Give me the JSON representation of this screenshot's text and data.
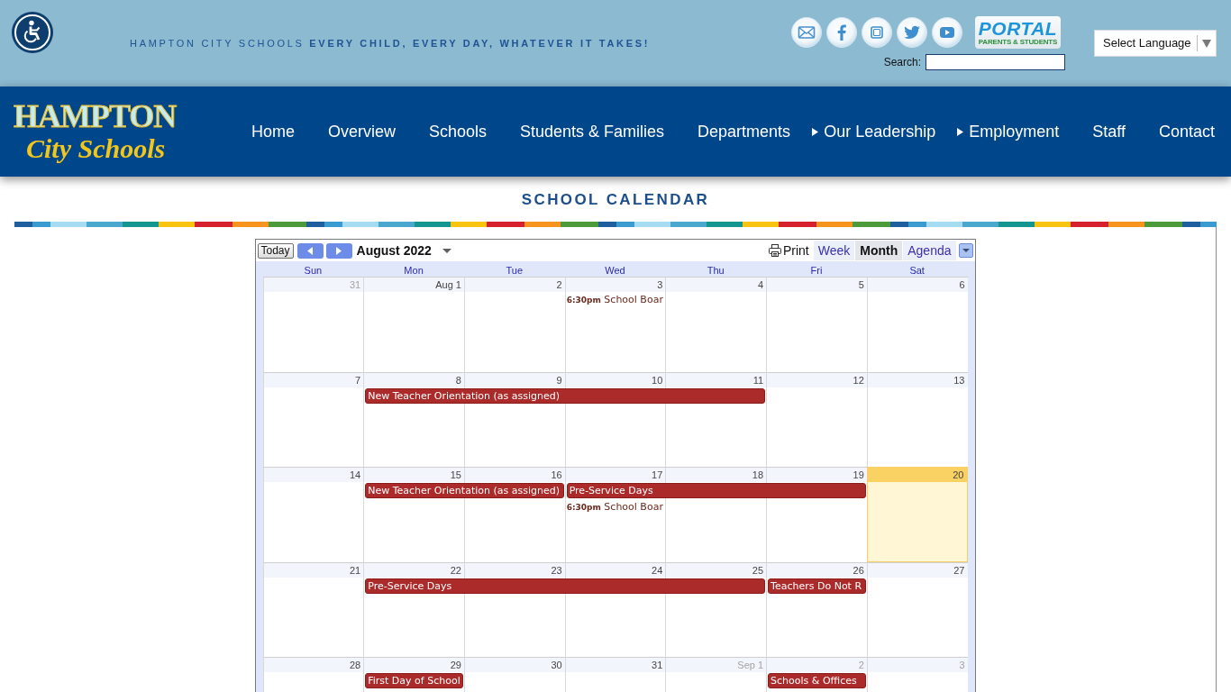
{
  "header": {
    "tagline": "HAMPTON CITY SCHOOLS **EVERY CHILD, EVERY DAY, WHATEVER IT TAKES!**",
    "portal": {
      "title": "PORTAL",
      "subtitle": "PARENTS & STUDENTS"
    },
    "search": {
      "label": "Search:"
    },
    "language_select": {
      "value": "Select Language"
    }
  },
  "logo": {
    "wordmark": "HAMPTON",
    "script": "City Schools"
  },
  "nav": [
    {
      "label": "Home",
      "submenu": false
    },
    {
      "label": "Overview",
      "submenu": false
    },
    {
      "label": "Schools",
      "submenu": false
    },
    {
      "label": "Students & Families",
      "submenu": false
    },
    {
      "label": "Departments",
      "submenu": false
    },
    {
      "label": "Our Leadership",
      "submenu": true
    },
    {
      "label": "Employment",
      "submenu": true
    },
    {
      "label": "Staff",
      "submenu": false
    },
    {
      "label": "Contact",
      "submenu": false
    }
  ],
  "page_title": "SCHOOL CALENDAR",
  "calendar": {
    "today_button": "Today",
    "month": "August 2022",
    "print": "Print",
    "views": [
      {
        "label": "Week",
        "selected": false
      },
      {
        "label": "Month",
        "selected": true
      },
      {
        "label": "Agenda",
        "selected": false
      }
    ],
    "weekdays": [
      "Sun",
      "Mon",
      "Tue",
      "Wed",
      "Thu",
      "Fri",
      "Sat"
    ],
    "weeks": [
      {
        "days": [
          {
            "date": "31",
            "other_month": true,
            "today": false
          },
          {
            "date": "Aug 1",
            "other_month": false,
            "today": false
          },
          {
            "date": "2",
            "other_month": false,
            "today": false
          },
          {
            "date": "3",
            "other_month": false,
            "today": false,
            "events": [
              {
                "kind": "timed",
                "time": "6:30pm",
                "title": "School Boar"
              }
            ]
          },
          {
            "date": "4",
            "other_month": false,
            "today": false
          },
          {
            "date": "5",
            "other_month": false,
            "today": false
          },
          {
            "date": "6",
            "other_month": false,
            "today": false
          }
        ]
      },
      {
        "days": [
          {
            "date": "7",
            "other_month": false,
            "today": false
          },
          {
            "date": "8",
            "other_month": false,
            "today": false,
            "events": [
              {
                "kind": "all_day",
                "title": "New Teacher Orientation (as assigned)"
              }
            ]
          },
          {
            "date": "9",
            "other_month": false,
            "today": false,
            "events": [
              {
                "kind": "continued"
              }
            ]
          },
          {
            "date": "10",
            "other_month": false,
            "today": false,
            "events": [
              {
                "kind": "continued"
              }
            ]
          },
          {
            "date": "11",
            "other_month": false,
            "today": false,
            "events": [
              {
                "kind": "continued"
              }
            ]
          },
          {
            "date": "12",
            "other_month": false,
            "today": false
          },
          {
            "date": "13",
            "other_month": false,
            "today": false
          }
        ]
      },
      {
        "days": [
          {
            "date": "14",
            "other_month": false,
            "today": false
          },
          {
            "date": "15",
            "other_month": false,
            "today": false,
            "events": [
              {
                "kind": "all_day",
                "title": "New Teacher Orientation (as assigned)"
              }
            ]
          },
          {
            "date": "16",
            "other_month": false,
            "today": false,
            "events": [
              {
                "kind": "continued"
              }
            ]
          },
          {
            "date": "17",
            "other_month": false,
            "today": false,
            "events": [
              {
                "kind": "all_day",
                "title": "Pre-Service Days"
              },
              {
                "kind": "timed",
                "time": "6:30pm",
                "title": "School Boar"
              }
            ]
          },
          {
            "date": "18",
            "other_month": false,
            "today": false,
            "events": [
              {
                "kind": "continued"
              }
            ]
          },
          {
            "date": "19",
            "other_month": false,
            "today": false,
            "events": [
              {
                "kind": "continued"
              }
            ]
          },
          {
            "date": "20",
            "other_month": false,
            "today": true
          }
        ]
      },
      {
        "days": [
          {
            "date": "21",
            "other_month": false,
            "today": false
          },
          {
            "date": "22",
            "other_month": false,
            "today": false,
            "events": [
              {
                "kind": "all_day",
                "title": "Pre-Service Days"
              }
            ]
          },
          {
            "date": "23",
            "other_month": false,
            "today": false,
            "events": [
              {
                "kind": "continued"
              }
            ]
          },
          {
            "date": "24",
            "other_month": false,
            "today": false,
            "events": [
              {
                "kind": "continued"
              }
            ]
          },
          {
            "date": "25",
            "other_month": false,
            "today": false,
            "events": [
              {
                "kind": "continued"
              }
            ]
          },
          {
            "date": "26",
            "other_month": false,
            "today": false,
            "events": [
              {
                "kind": "all_day",
                "title": "Teachers Do Not R"
              }
            ]
          },
          {
            "date": "27",
            "other_month": false,
            "today": false
          }
        ]
      },
      {
        "days": [
          {
            "date": "28",
            "other_month": false,
            "today": false
          },
          {
            "date": "29",
            "other_month": false,
            "today": false,
            "events": [
              {
                "kind": "all_day",
                "title": "First Day of School"
              }
            ]
          },
          {
            "date": "30",
            "other_month": false,
            "today": false
          },
          {
            "date": "31",
            "other_month": false,
            "today": false
          },
          {
            "date": "Sep 1",
            "other_month": true,
            "today": false
          },
          {
            "date": "2",
            "other_month": true,
            "today": false,
            "events": [
              {
                "kind": "all_day",
                "title": "Schools & Offices"
              }
            ]
          },
          {
            "date": "3",
            "other_month": true,
            "today": false
          }
        ]
      }
    ]
  }
}
